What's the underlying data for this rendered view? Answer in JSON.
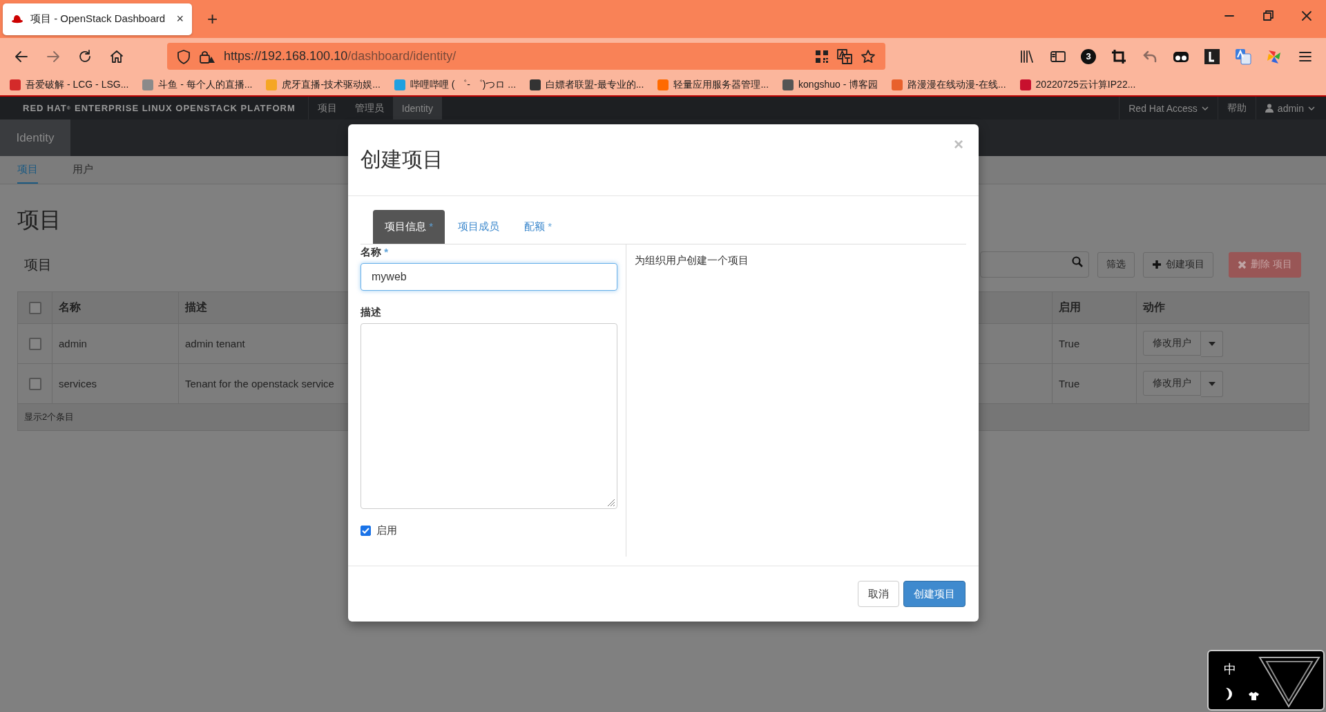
{
  "browser": {
    "tab": {
      "title": "项目 - OpenStack Dashboard",
      "close": "×"
    },
    "new_tab": "+",
    "url": {
      "host": "https://192.168.100.10",
      "path": "/dashboard/identity/"
    },
    "extension_badge": "3",
    "bookmarks": [
      {
        "label": "吾爱破解 - LCG - LSG...",
        "color": "#d42a2a"
      },
      {
        "label": "斗鱼 - 每个人的直播...",
        "color": "#8a8a8a"
      },
      {
        "label": "虎牙直播-技术驱动娱...",
        "color": "#f5a623"
      },
      {
        "label": "哔哩哔哩 ( ゜- ゜)つロ ...",
        "color": "#20a0e0"
      },
      {
        "label": "白嫖者联盟-最专业的...",
        "color": "#333333"
      },
      {
        "label": "轻量应用服务器管理...",
        "color": "#ff6a00"
      },
      {
        "label": "kongshuo - 博客园",
        "color": "#555555"
      },
      {
        "label": "路漫漫在线动漫-在线...",
        "color": "#e8612c"
      },
      {
        "label": "20220725云计算IP22...",
        "color": "#c8102e"
      }
    ]
  },
  "header": {
    "brand": "RED HAT$^{®}$ ENTERPRISE LINUX OPENSTACK PLATFORM",
    "nav": [
      {
        "label": "项目",
        "selected": false
      },
      {
        "label": "管理员",
        "selected": false
      },
      {
        "label": "Identity",
        "selected": true
      }
    ],
    "access": "Red Hat Access",
    "help": "帮助",
    "user": "admin"
  },
  "panel": {
    "label": "Identity"
  },
  "subnav": [
    {
      "label": "项目",
      "selected": true
    },
    {
      "label": "用户",
      "selected": false
    }
  ],
  "page_title": "项目",
  "table": {
    "title": "项目",
    "actions": [
      {
        "label": "筛选",
        "kind": "filter",
        "disabled": false
      },
      {
        "label": "创建项目",
        "kind": "create",
        "disabled": false
      },
      {
        "label": "删除 项目",
        "kind": "delete",
        "disabled": true
      }
    ],
    "select_all": {
      "checked": false
    },
    "columns": [
      "名称",
      "描述",
      "启用",
      "动作"
    ],
    "rows": [
      {
        "checked": false,
        "name": "admin",
        "description": "admin tenant",
        "enabled": "True",
        "action": "修改用户"
      },
      {
        "checked": false,
        "name": "services",
        "description": "Tenant for the openstack service",
        "enabled": "True",
        "action": "修改用户"
      }
    ],
    "footer": "显示2个条目"
  },
  "modal": {
    "title": "创建项目",
    "close": "×",
    "required_mark": "*",
    "tabs": [
      {
        "label": "项目信息",
        "required": true,
        "selected": true
      },
      {
        "label": "项目成员",
        "required": false,
        "selected": false
      },
      {
        "label": "配额",
        "required": true,
        "selected": false
      }
    ],
    "name_label": "名称",
    "name_required": true,
    "name_value": "myweb",
    "description_label": "描述",
    "enabled": {
      "label": "启用",
      "checked": true
    },
    "help": "为组织用户创建一个项目",
    "buttons": [
      {
        "label": "取消",
        "kind": "cancel"
      },
      {
        "label": "创建项目",
        "kind": "primary"
      }
    ]
  },
  "ime": {
    "label": "中"
  }
}
